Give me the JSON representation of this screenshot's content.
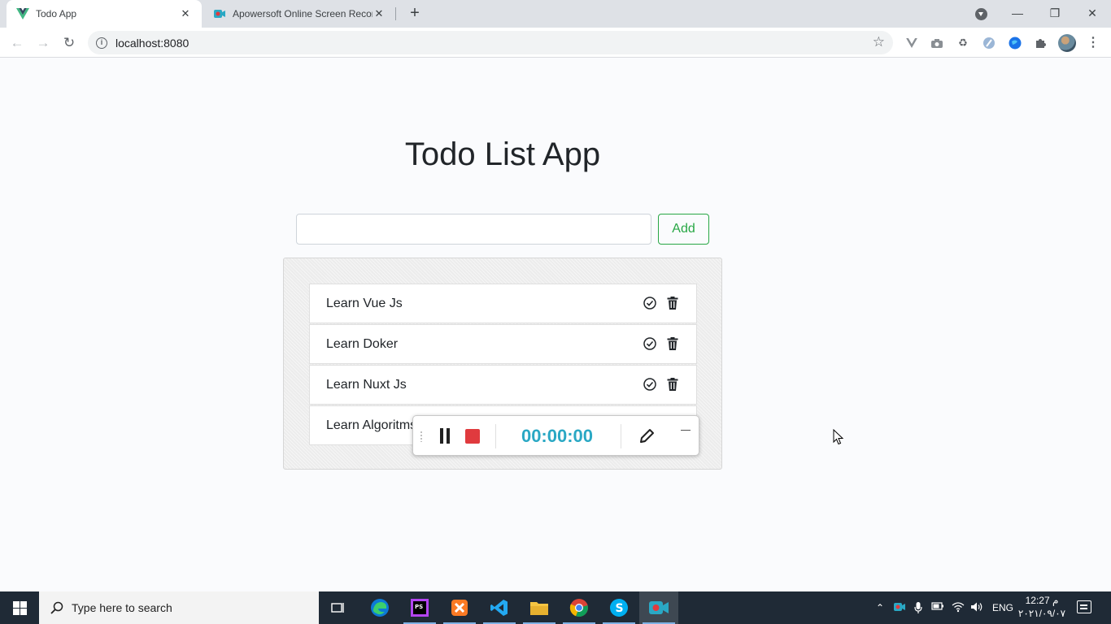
{
  "browser": {
    "tabs": [
      {
        "title": "Todo App",
        "active": true
      },
      {
        "title": "Apowersoft Online Screen Recorder",
        "active": false
      }
    ],
    "new_tab_label": "+",
    "window_controls": {
      "minimize": "—",
      "restore": "❐",
      "close": "✕"
    },
    "address": "localhost:8080",
    "extensions": [
      "vue-devtools-icon",
      "camera-icon",
      "recycle-icon",
      "edge-ext-icon",
      "globe-icon",
      "puzzle-icon"
    ]
  },
  "app": {
    "title": "Todo List App",
    "input_value": "",
    "add_label": "Add",
    "todos": [
      {
        "text": "Learn Vue Js"
      },
      {
        "text": "Learn Doker"
      },
      {
        "text": "Learn Nuxt Js"
      },
      {
        "text": "Learn Algoritms"
      }
    ]
  },
  "recorder": {
    "timer": "00:00:00",
    "accent": "#2aa8c4",
    "stop_color": "#e03a3e"
  },
  "taskbar": {
    "search_placeholder": "Type here to search",
    "apps": [
      "task-view-icon",
      "edge-icon",
      "phpstorm-icon",
      "xampp-icon",
      "vscode-icon",
      "file-explorer-icon",
      "chrome-icon",
      "skype-icon",
      "recorder-app-icon"
    ],
    "language": "ENG",
    "time": "12:27 م",
    "date": "٢٠٢١/٠٩/٠٧"
  }
}
